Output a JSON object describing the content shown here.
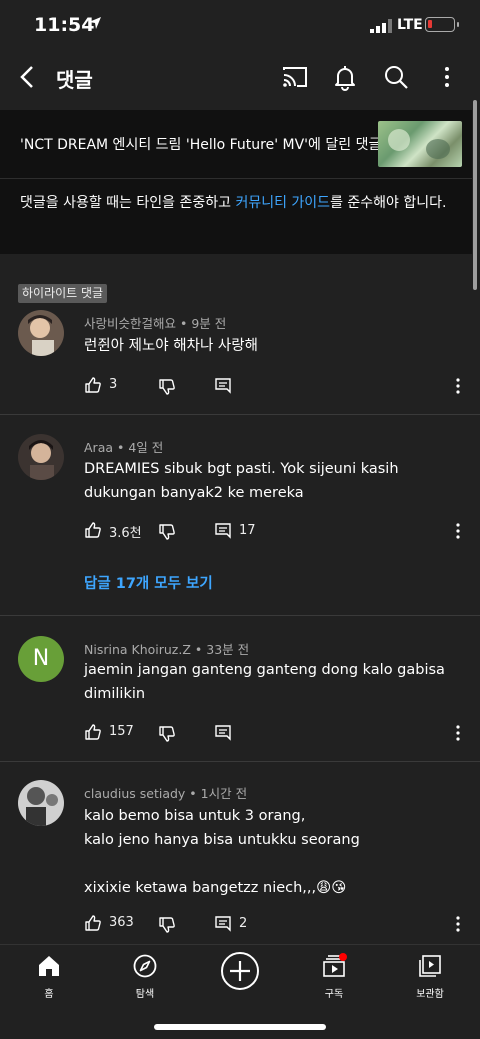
{
  "status_bar": {
    "time": "11:54",
    "network": "LTE"
  },
  "header": {
    "title": "댓글"
  },
  "video": {
    "title": "'NCT DREAM 엔시티 드림 'Hello Future' MV'에 달린 댓글",
    "guide_before": "댓글을 사용할 때는 타인을 존중하고 ",
    "guide_link": "커뮤니티 가이드",
    "guide_after": "를 준수해야 합니다."
  },
  "highlight_label": "하이라이트 댓글",
  "comments": [
    {
      "author": "사랑비슷한걸해요",
      "time": "• 9분 전",
      "text": "런쥔아 제노야 해차나 사랑해",
      "likes": "3",
      "replies": ""
    },
    {
      "author": "Araa",
      "time": "• 4일 전",
      "text": "DREAMIES sibuk bgt pasti. Yok sijeuni kasih\ndukungan banyak2 ke mereka",
      "likes": "3.6천",
      "replies": "17",
      "replies_link": "답글 17개 모두 보기"
    },
    {
      "author": "Nisrina Khoiruz.Z",
      "time": "• 33분 전",
      "text": "jaemin jangan ganteng ganteng dong kalo gabisa\ndimilikin",
      "likes": "157",
      "replies": "",
      "avatar_letter": "N",
      "avatar_color": "#689f38"
    },
    {
      "author": "claudius setiady",
      "time": "• 1시간 전",
      "text": "kalo bemo bisa untuk 3 orang,\nkalo jeno hanya bisa untukku seorang\n\nxixixie ketawa bangetzz niech,,,😩😘",
      "likes": "363",
      "replies": "2"
    }
  ],
  "nav": {
    "home": "홈",
    "explore": "탐색",
    "subscriptions": "구독",
    "library": "보관함"
  },
  "colors": {
    "accent": "#3ea6ff",
    "background": "#212121",
    "notification_dot": "#ff0000"
  }
}
